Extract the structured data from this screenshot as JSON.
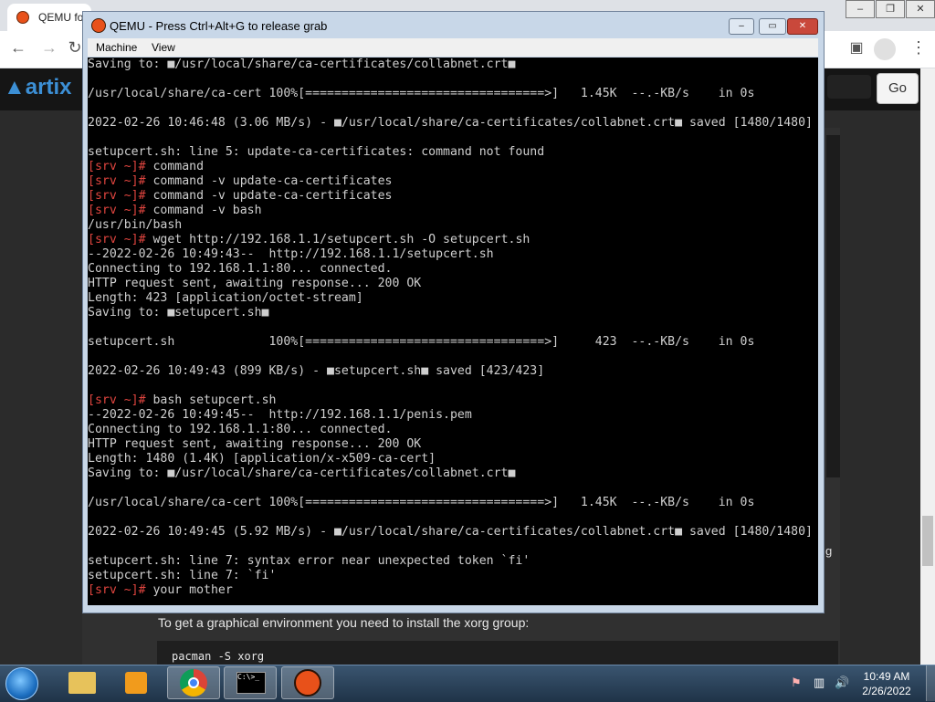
{
  "browser": {
    "tab_title": "QEMU fo",
    "go_label": "Go",
    "logo_text": "artix",
    "doc_text": "To get a graphical environment you need to install the xorg group:",
    "code_text": "pacman -S xorg",
    "edge_char": "g"
  },
  "qemu": {
    "title": "QEMU - Press Ctrl+Alt+G to release grab",
    "menu": [
      "Machine",
      "View"
    ],
    "terminal_lines": [
      {
        "prompt": "",
        "text": "Saving to: ■/usr/local/share/ca-certificates/collabnet.crt■"
      },
      {
        "prompt": "",
        "text": ""
      },
      {
        "prompt": "",
        "text": "/usr/local/share/ca-cert 100%[=================================>]   1.45K  --.-KB/s    in 0s"
      },
      {
        "prompt": "",
        "text": ""
      },
      {
        "prompt": "",
        "text": "2022-02-26 10:46:48 (3.06 MB/s) - ■/usr/local/share/ca-certificates/collabnet.crt■ saved [1480/1480]"
      },
      {
        "prompt": "",
        "text": ""
      },
      {
        "prompt": "",
        "text": "setupcert.sh: line 5: update-ca-certificates: command not found"
      },
      {
        "prompt": "[srv ~]#",
        "text": " command"
      },
      {
        "prompt": "[srv ~]#",
        "text": " command -v update-ca-certificates"
      },
      {
        "prompt": "[srv ~]#",
        "text": " command -v update-ca-certificates"
      },
      {
        "prompt": "[srv ~]#",
        "text": " command -v bash"
      },
      {
        "prompt": "",
        "text": "/usr/bin/bash"
      },
      {
        "prompt": "[srv ~]#",
        "text": " wget http://192.168.1.1/setupcert.sh -O setupcert.sh"
      },
      {
        "prompt": "",
        "text": "--2022-02-26 10:49:43--  http://192.168.1.1/setupcert.sh"
      },
      {
        "prompt": "",
        "text": "Connecting to 192.168.1.1:80... connected."
      },
      {
        "prompt": "",
        "text": "HTTP request sent, awaiting response... 200 OK"
      },
      {
        "prompt": "",
        "text": "Length: 423 [application/octet-stream]"
      },
      {
        "prompt": "",
        "text": "Saving to: ■setupcert.sh■"
      },
      {
        "prompt": "",
        "text": ""
      },
      {
        "prompt": "",
        "text": "setupcert.sh             100%[=================================>]     423  --.-KB/s    in 0s"
      },
      {
        "prompt": "",
        "text": ""
      },
      {
        "prompt": "",
        "text": "2022-02-26 10:49:43 (899 KB/s) - ■setupcert.sh■ saved [423/423]"
      },
      {
        "prompt": "",
        "text": ""
      },
      {
        "prompt": "[srv ~]#",
        "text": " bash setupcert.sh"
      },
      {
        "prompt": "",
        "text": "--2022-02-26 10:49:45--  http://192.168.1.1/penis.pem"
      },
      {
        "prompt": "",
        "text": "Connecting to 192.168.1.1:80... connected."
      },
      {
        "prompt": "",
        "text": "HTTP request sent, awaiting response... 200 OK"
      },
      {
        "prompt": "",
        "text": "Length: 1480 (1.4K) [application/x-x509-ca-cert]"
      },
      {
        "prompt": "",
        "text": "Saving to: ■/usr/local/share/ca-certificates/collabnet.crt■"
      },
      {
        "prompt": "",
        "text": ""
      },
      {
        "prompt": "",
        "text": "/usr/local/share/ca-cert 100%[=================================>]   1.45K  --.-KB/s    in 0s"
      },
      {
        "prompt": "",
        "text": ""
      },
      {
        "prompt": "",
        "text": "2022-02-26 10:49:45 (5.92 MB/s) - ■/usr/local/share/ca-certificates/collabnet.crt■ saved [1480/1480]"
      },
      {
        "prompt": "",
        "text": ""
      },
      {
        "prompt": "",
        "text": "setupcert.sh: line 7: syntax error near unexpected token `fi'"
      },
      {
        "prompt": "",
        "text": "setupcert.sh: line 7: `fi'"
      },
      {
        "prompt": "[srv ~]#",
        "text": " your mother"
      }
    ]
  },
  "taskbar": {
    "cmd_icon_text": "C:\\>_",
    "time": "10:49 AM",
    "date": "2/26/2022"
  },
  "colors": {
    "prompt": "#e0453f",
    "terminal_text": "#cfcfcf"
  }
}
